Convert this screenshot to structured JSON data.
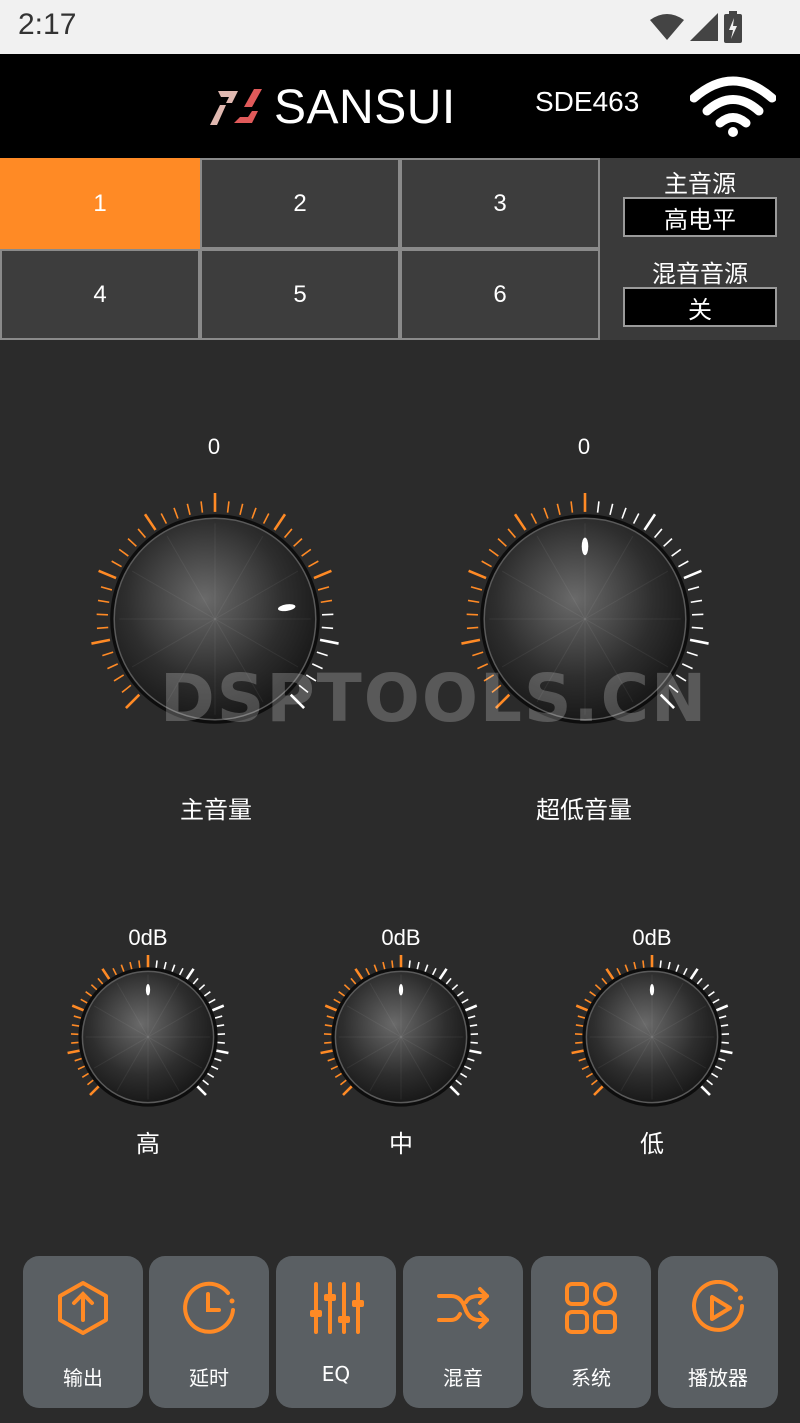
{
  "status": {
    "time": "2:17"
  },
  "header": {
    "brand": "SANSUI",
    "model": "SDE463"
  },
  "presets": [
    "1",
    "2",
    "3",
    "4",
    "5",
    "6"
  ],
  "active_preset": 0,
  "sources": {
    "main_label": "主音源",
    "main_value": "高电平",
    "mix_label": "混音音源",
    "mix_value": "关"
  },
  "big_knobs": [
    {
      "label": "主音量",
      "value": "0",
      "level": 0.8
    },
    {
      "label": "超低音量",
      "value": "0",
      "level": 0.5
    }
  ],
  "eq_knobs": [
    {
      "label": "高",
      "value": "0dB",
      "level": 0.5
    },
    {
      "label": "中",
      "value": "0dB",
      "level": 0.5
    },
    {
      "label": "低",
      "value": "0dB",
      "level": 0.5
    }
  ],
  "watermark": "DSPTOOLS.CN",
  "nav": [
    {
      "label": "输出",
      "icon": "output-icon"
    },
    {
      "label": "延时",
      "icon": "delay-icon"
    },
    {
      "label": "EQ",
      "icon": "eq-icon"
    },
    {
      "label": "混音",
      "icon": "mix-icon"
    },
    {
      "label": "系统",
      "icon": "system-icon"
    },
    {
      "label": "播放器",
      "icon": "player-icon"
    }
  ],
  "colors": {
    "accent": "#ff8a25",
    "background": "#2b2b2b",
    "header": "#000000"
  }
}
